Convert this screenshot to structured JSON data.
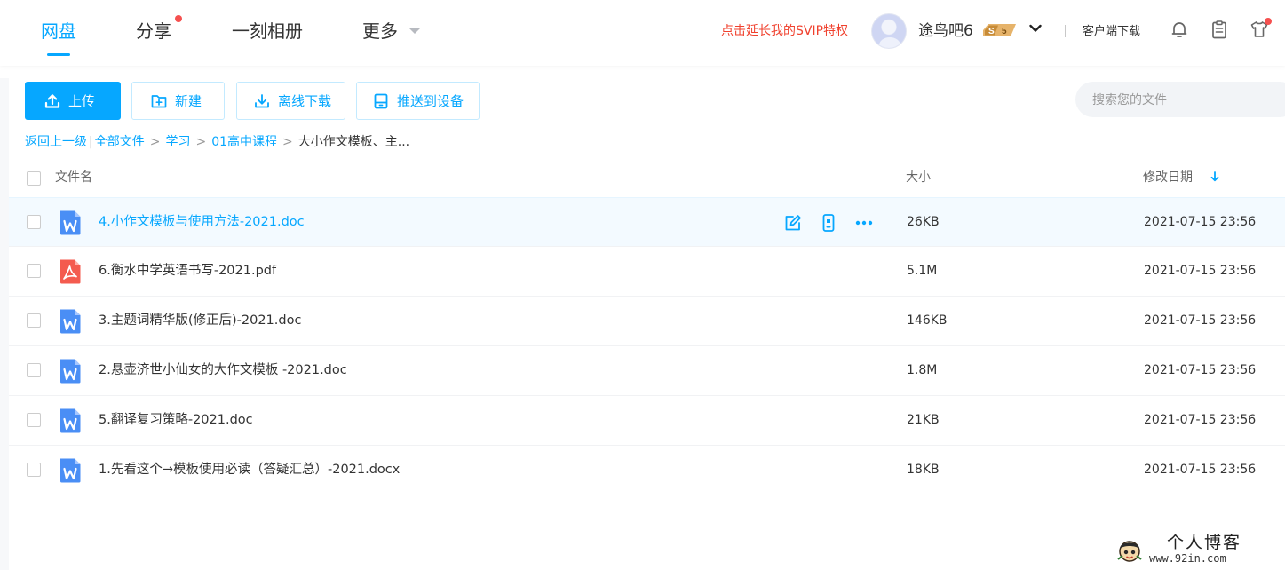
{
  "nav": {
    "tabs": [
      {
        "label": "网盘",
        "active": true
      },
      {
        "label": "分享",
        "has_dot": true
      },
      {
        "label": "一刻相册"
      },
      {
        "label": "更多"
      }
    ],
    "svip_link": "点击延长我的SVIP特权",
    "user": {
      "name": "途鸟吧6",
      "badge_level": "5"
    },
    "client_download": "客户端下载",
    "icons": [
      "bell-icon",
      "clipboard-icon",
      "tshirt-icon"
    ]
  },
  "toolbar": {
    "upload": "上传",
    "new": "新建",
    "offline_download": "离线下载",
    "push_device": "推送到设备",
    "search_placeholder": "搜索您的文件"
  },
  "breadcrumb": {
    "back": "返回上一级",
    "all_files": "全部文件",
    "path": [
      "学习",
      "01高中课程"
    ],
    "current": "大小作文模板、主..."
  },
  "table": {
    "headers": {
      "name": "文件名",
      "size": "大小",
      "date": "修改日期"
    },
    "rows": [
      {
        "name": "4.小作文模板与使用方法-2021.doc",
        "size": "26KB",
        "date": "2021-07-15 23:56",
        "type": "word",
        "hover": true
      },
      {
        "name": "6.衡水中学英语书写-2021.pdf",
        "size": "5.1M",
        "date": "2021-07-15 23:56",
        "type": "pdf"
      },
      {
        "name": "3.主题词精华版(修正后)-2021.doc",
        "size": "146KB",
        "date": "2021-07-15 23:56",
        "type": "word"
      },
      {
        "name": "2.悬壶济世小仙女的大作文模板 -2021.doc",
        "size": "1.8M",
        "date": "2021-07-15 23:56",
        "type": "word"
      },
      {
        "name": "5.翻译复习策略-2021.doc",
        "size": "21KB",
        "date": "2021-07-15 23:56",
        "type": "word"
      },
      {
        "name": "1.先看这个→模板使用必读（答疑汇总）-2021.docx",
        "size": "18KB",
        "date": "2021-07-15 23:56",
        "type": "word"
      }
    ]
  },
  "watermark": {
    "title": "个人博客",
    "url": "www.92in.com"
  },
  "colors": {
    "accent": "#06a7ff",
    "danger": "#f0412e",
    "pdf": "#f45b4f",
    "word": "#4a8ef5"
  }
}
